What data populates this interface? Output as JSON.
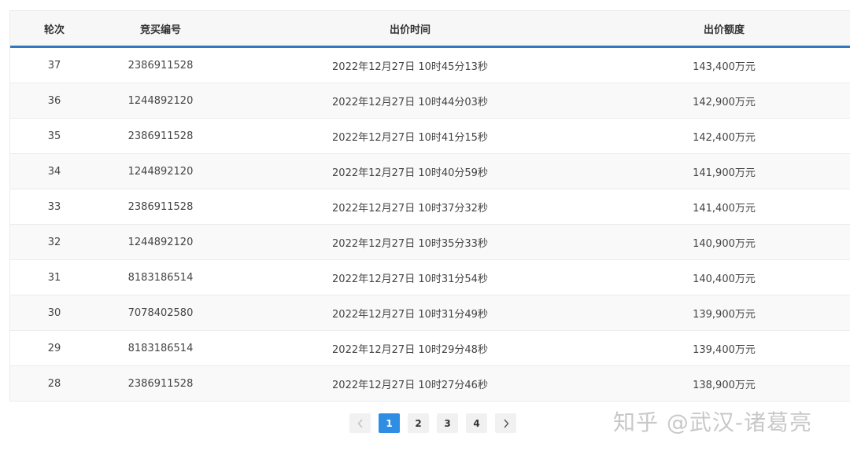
{
  "table": {
    "headers": {
      "round": "轮次",
      "bidder": "竞买编号",
      "time": "出价时间",
      "amount": "出价额度"
    },
    "rows": [
      {
        "round": "37",
        "bidder": "2386911528",
        "time": "2022年12月27日 10时45分13秒",
        "amount": "143,400万元"
      },
      {
        "round": "36",
        "bidder": "1244892120",
        "time": "2022年12月27日 10时44分03秒",
        "amount": "142,900万元"
      },
      {
        "round": "35",
        "bidder": "2386911528",
        "time": "2022年12月27日 10时41分15秒",
        "amount": "142,400万元"
      },
      {
        "round": "34",
        "bidder": "1244892120",
        "time": "2022年12月27日 10时40分59秒",
        "amount": "141,900万元"
      },
      {
        "round": "33",
        "bidder": "2386911528",
        "time": "2022年12月27日 10时37分32秒",
        "amount": "141,400万元"
      },
      {
        "round": "32",
        "bidder": "1244892120",
        "time": "2022年12月27日 10时35分33秒",
        "amount": "140,900万元"
      },
      {
        "round": "31",
        "bidder": "8183186514",
        "time": "2022年12月27日 10时31分54秒",
        "amount": "140,400万元"
      },
      {
        "round": "30",
        "bidder": "7078402580",
        "time": "2022年12月27日 10时31分49秒",
        "amount": "139,900万元"
      },
      {
        "round": "29",
        "bidder": "8183186514",
        "time": "2022年12月27日 10时29分48秒",
        "amount": "139,400万元"
      },
      {
        "round": "28",
        "bidder": "2386911528",
        "time": "2022年12月27日 10时27分46秒",
        "amount": "138,900万元"
      }
    ]
  },
  "pagination": {
    "prev_icon": "chevron-left-icon",
    "next_icon": "chevron-right-icon",
    "pages": [
      "1",
      "2",
      "3",
      "4"
    ],
    "current": "1"
  },
  "watermark": "知乎 @武汉-诸葛亮",
  "colors": {
    "header_border": "#2f79c2",
    "active_page": "#2f8de4"
  }
}
